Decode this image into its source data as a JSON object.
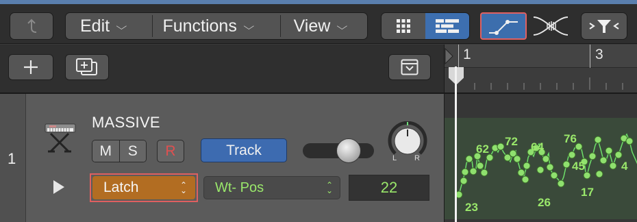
{
  "toolbar": {
    "menus": [
      {
        "label": "Edit"
      },
      {
        "label": "Functions"
      },
      {
        "label": "View"
      }
    ]
  },
  "ruler": {
    "bar_start": "1",
    "bar_next": "3"
  },
  "track": {
    "number": "1",
    "name": "MASSIVE",
    "mute": "M",
    "solo": "S",
    "record": "R",
    "track_button": "Track",
    "pan_left": "L",
    "pan_right": "R",
    "automation_mode": "Latch",
    "automation_param": "Wt- Pos",
    "automation_value": "22",
    "volume_level": 0.72
  },
  "automation_labels": [
    "62",
    "72",
    "64",
    "76",
    "45",
    "4",
    "23",
    "26",
    "17"
  ],
  "colors": {
    "accent_blue": "#3d6fb0",
    "latch_orange": "#b26d22",
    "automation_green": "#9ae86b",
    "highlight_red": "#e06060"
  }
}
